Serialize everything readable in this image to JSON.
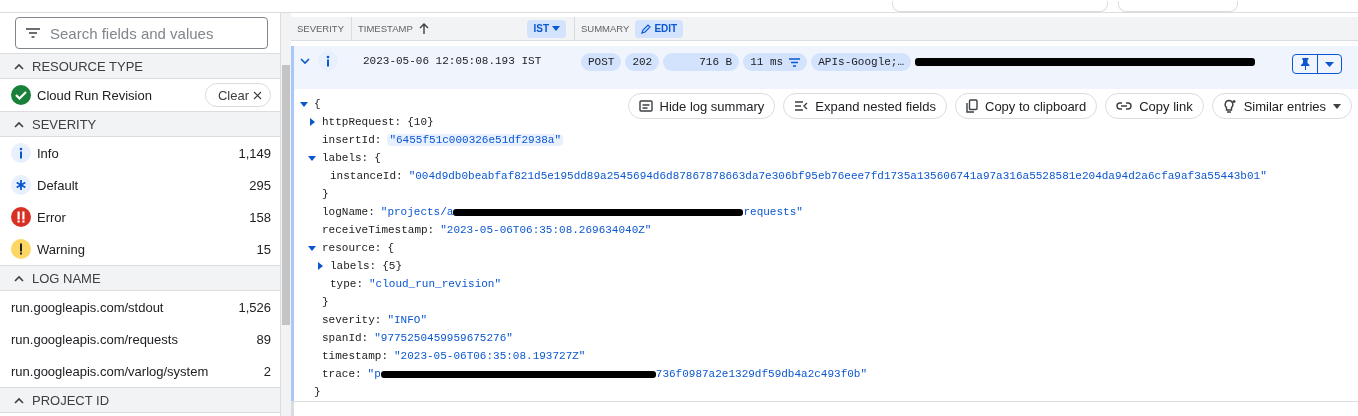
{
  "sidebar": {
    "search": {
      "placeholder": "Search fields and values"
    },
    "sections": [
      {
        "title": "RESOURCE TYPE",
        "expanded": true,
        "items": [
          {
            "kind": "resource",
            "label": "Cloud Run Revision",
            "checked": true,
            "action": "Clear"
          }
        ]
      },
      {
        "title": "SEVERITY",
        "expanded": true,
        "items": [
          {
            "kind": "info",
            "label": "Info",
            "count": "1,149"
          },
          {
            "kind": "default",
            "label": "Default",
            "count": "295"
          },
          {
            "kind": "error",
            "label": "Error",
            "count": "158"
          },
          {
            "kind": "warning",
            "label": "Warning",
            "count": "15"
          }
        ]
      },
      {
        "title": "LOG NAME",
        "expanded": true,
        "items": [
          {
            "kind": "plain",
            "label": "run.googleapis.com/stdout",
            "count": "1,526"
          },
          {
            "kind": "plain",
            "label": "run.googleapis.com/requests",
            "count": "89"
          },
          {
            "kind": "plain",
            "label": "run.googleapis.com/varlog/system",
            "count": "2"
          }
        ]
      },
      {
        "title": "PROJECT ID",
        "expanded": true
      }
    ]
  },
  "table": {
    "columns": [
      {
        "kind": "plain",
        "label": "SEVERITY"
      },
      {
        "kind": "timestamp",
        "label": "TIMESTAMP",
        "sort_ascending": true,
        "timezone": "IST"
      },
      {
        "kind": "summary",
        "label": "SUMMARY",
        "action": "EDIT"
      }
    ],
    "rows": [
      {
        "expanded": true,
        "kind": "info",
        "timestamp": "2023-05-06 12:05:08.193 IST",
        "redacted": true,
        "chips": [
          {
            "kind": "text",
            "label": "POST"
          },
          {
            "kind": "text",
            "label": "202"
          },
          {
            "kind": "size",
            "label": "716 B"
          },
          {
            "kind": "latency",
            "label": "11 ms"
          },
          {
            "kind": "text",
            "label": "APIs-Google;…"
          }
        ],
        "detail": {
          "actions": [
            {
              "kind": "summary",
              "label": "Hide log summary"
            },
            {
              "kind": "expand",
              "label": "Expand nested fields"
            },
            {
              "kind": "copy",
              "label": "Copy to clipboard"
            },
            {
              "kind": "link",
              "label": "Copy link"
            },
            {
              "kind": "similar",
              "label": "Similar entries"
            }
          ],
          "tree": {
            "kind": "object",
            "open": "{",
            "expanded": true,
            "close": "}",
            "children": [
              {
                "kind": "object",
                "key": "httpRequest:",
                "summary": "{10}",
                "expanded": false
              },
              {
                "kind": "string",
                "key": "insertId:",
                "value": "\"6455f51c000326e51df2938a\"",
                "highlighted": true
              },
              {
                "kind": "object",
                "key": "labels:",
                "open": "{",
                "expanded": true,
                "close": "}",
                "children": [
                  {
                    "kind": "string",
                    "key": "instanceId:",
                    "value": "\"004d9db0beabfaf821d5e195dd89a2545694d6d87867878663da7e306bf95eb76eee7fd1735a135606741a97a316a5528581e204da94d2a6cfa9af3a55443b01\""
                  }
                ]
              },
              {
                "kind": "redacted",
                "key": "logName:",
                "value_start": "\"projects/a",
                "value_end": "requests\""
              },
              {
                "kind": "string",
                "key": "receiveTimestamp:",
                "value": "\"2023-05-06T06:35:08.269634040Z\""
              },
              {
                "kind": "object",
                "key": "resource:",
                "open": "{",
                "expanded": true,
                "close": "}",
                "children": [
                  {
                    "kind": "object",
                    "key": "labels:",
                    "summary": "{5}",
                    "expanded": false
                  },
                  {
                    "kind": "string",
                    "key": "type:",
                    "value": "\"cloud_run_revision\""
                  }
                ]
              },
              {
                "kind": "string",
                "key": "severity:",
                "value": "\"INFO\""
              },
              {
                "kind": "string",
                "key": "spanId:",
                "value": "\"9775250459959675276\""
              },
              {
                "kind": "string",
                "key": "timestamp:",
                "value": "\"2023-05-06T06:35:08.193727Z\""
              },
              {
                "kind": "redacted",
                "key": "trace:",
                "value_start": "\"p",
                "value_end": "736f0987a2e1329df59db4a2c493f0b\""
              }
            ]
          }
        }
      }
    ]
  }
}
